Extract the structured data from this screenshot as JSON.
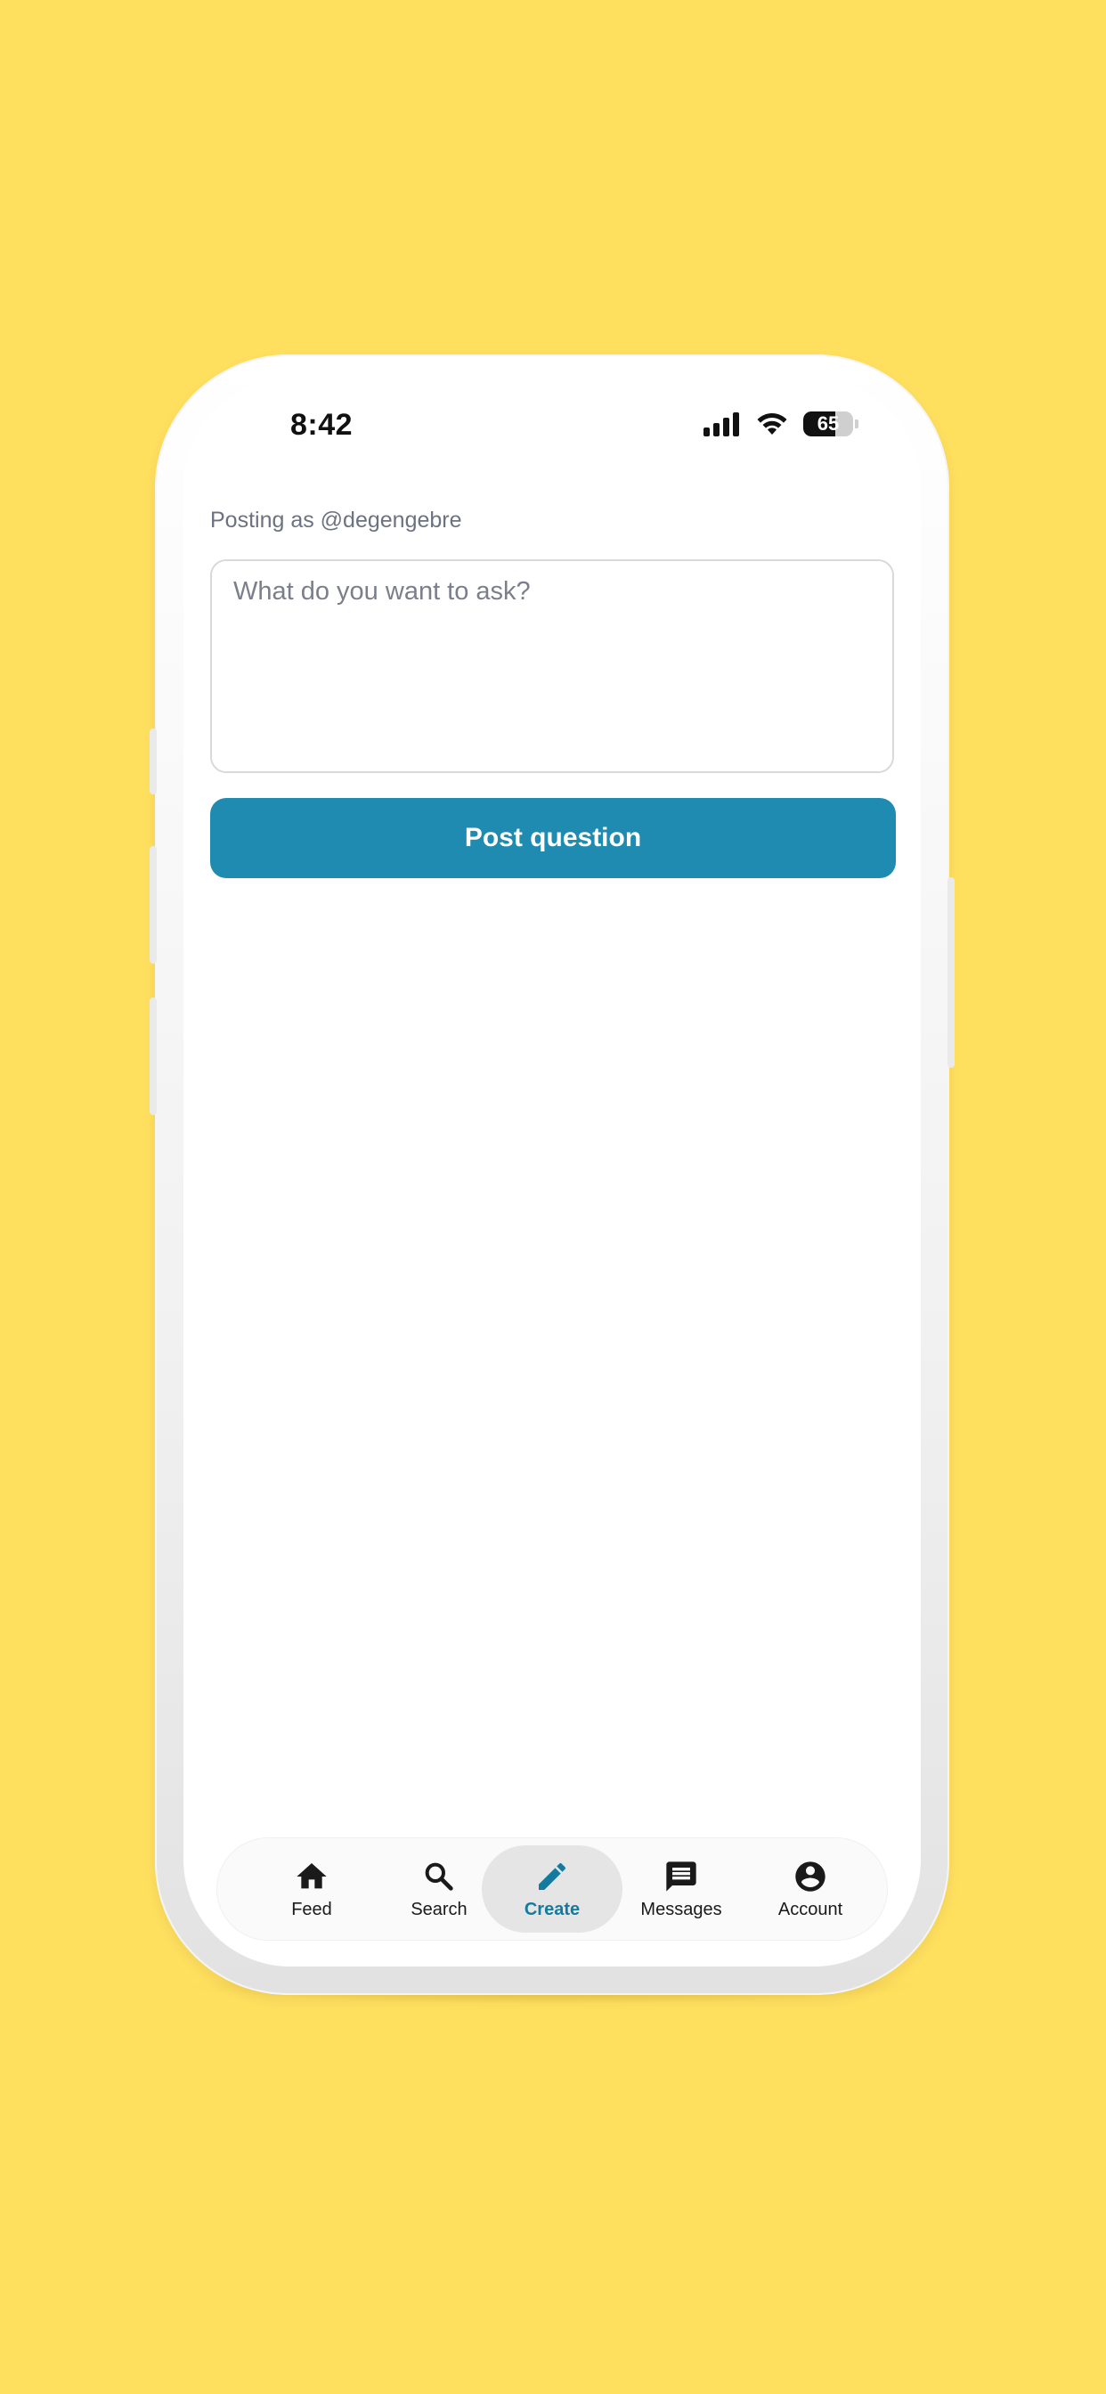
{
  "status_bar": {
    "time": "8:42",
    "battery": "65",
    "battery_level_percent": 65
  },
  "composer": {
    "posting_as": "Posting as @degengebre",
    "question_placeholder": "What do you want to ask?",
    "post_button_label": "Post question"
  },
  "tab_bar": {
    "active_tab": "Create",
    "tabs": [
      {
        "label": "Feed",
        "icon": "home-icon"
      },
      {
        "label": "Search",
        "icon": "search-icon"
      },
      {
        "label": "Create",
        "icon": "pencil-icon"
      },
      {
        "label": "Messages",
        "icon": "message-icon"
      },
      {
        "label": "Account",
        "icon": "account-icon"
      }
    ]
  },
  "colors": {
    "background": "#FFDF5E",
    "primary_button": "#208BB0",
    "active_tab_text": "#157A9F"
  }
}
